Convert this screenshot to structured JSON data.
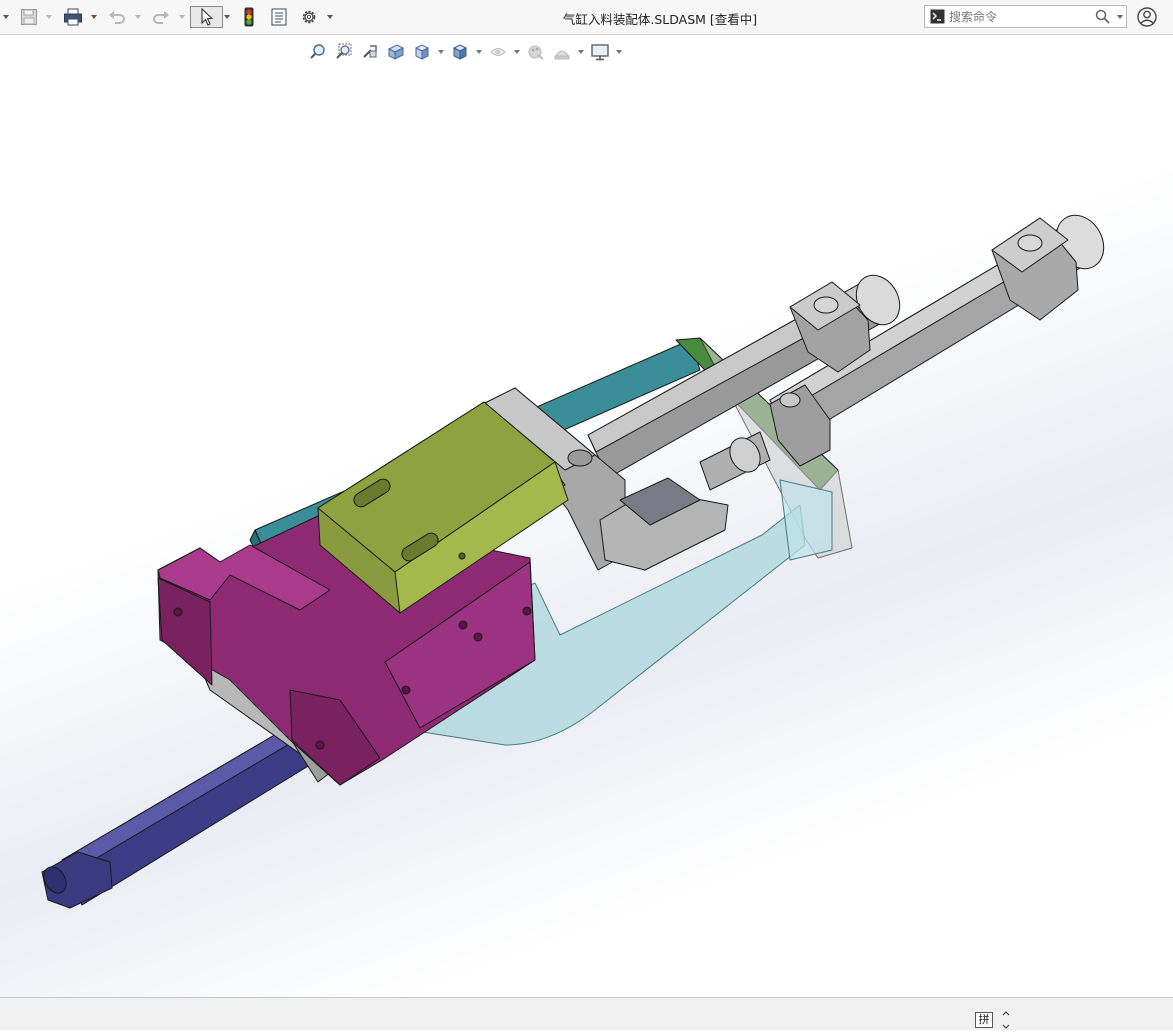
{
  "titlebar": {
    "document_title": "气缸入料装配体.SLDASM [查看中]",
    "search_placeholder": "搜索命令",
    "icons": {
      "save": "save-icon",
      "print": "print-icon",
      "undo": "undo-icon",
      "redo": "redo-icon",
      "select": "pointer-icon",
      "rebuild": "traffic-light-icon",
      "file_properties": "file-properties-icon",
      "options": "gear-icon",
      "user": "user-icon"
    }
  },
  "heads_up_toolbar": {
    "items": [
      "zoom-to-fit-icon",
      "zoom-to-area-icon",
      "previous-view-icon",
      "section-view-icon",
      "view-orientation-icon",
      "display-style-icon",
      "hide-show-items-icon",
      "edit-appearance-icon",
      "apply-scene-icon",
      "view-settings-icon"
    ]
  },
  "statusbar": {
    "grid_label": "拼"
  },
  "colors": {
    "magenta": "#8e2a73",
    "olive": "#8a9a3e",
    "teal": "#3a8e98",
    "green": "#4a8a3e",
    "navy": "#3c3c86",
    "steel": "#9a9a9a",
    "transparent_blue": "#a9d4dc"
  }
}
